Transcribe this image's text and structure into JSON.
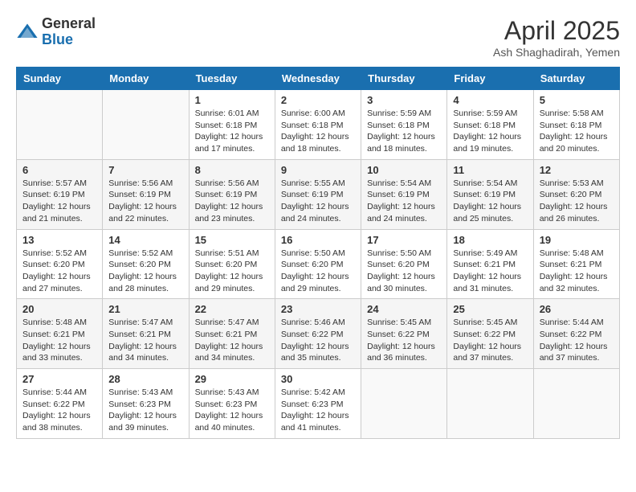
{
  "header": {
    "logo_general": "General",
    "logo_blue": "Blue",
    "month_year": "April 2025",
    "location": "Ash Shaghadirah, Yemen"
  },
  "weekdays": [
    "Sunday",
    "Monday",
    "Tuesday",
    "Wednesday",
    "Thursday",
    "Friday",
    "Saturday"
  ],
  "weeks": [
    [
      {
        "day": "",
        "sunrise": "",
        "sunset": "",
        "daylight": ""
      },
      {
        "day": "",
        "sunrise": "",
        "sunset": "",
        "daylight": ""
      },
      {
        "day": "1",
        "sunrise": "Sunrise: 6:01 AM",
        "sunset": "Sunset: 6:18 PM",
        "daylight": "Daylight: 12 hours and 17 minutes."
      },
      {
        "day": "2",
        "sunrise": "Sunrise: 6:00 AM",
        "sunset": "Sunset: 6:18 PM",
        "daylight": "Daylight: 12 hours and 18 minutes."
      },
      {
        "day": "3",
        "sunrise": "Sunrise: 5:59 AM",
        "sunset": "Sunset: 6:18 PM",
        "daylight": "Daylight: 12 hours and 18 minutes."
      },
      {
        "day": "4",
        "sunrise": "Sunrise: 5:59 AM",
        "sunset": "Sunset: 6:18 PM",
        "daylight": "Daylight: 12 hours and 19 minutes."
      },
      {
        "day": "5",
        "sunrise": "Sunrise: 5:58 AM",
        "sunset": "Sunset: 6:18 PM",
        "daylight": "Daylight: 12 hours and 20 minutes."
      }
    ],
    [
      {
        "day": "6",
        "sunrise": "Sunrise: 5:57 AM",
        "sunset": "Sunset: 6:19 PM",
        "daylight": "Daylight: 12 hours and 21 minutes."
      },
      {
        "day": "7",
        "sunrise": "Sunrise: 5:56 AM",
        "sunset": "Sunset: 6:19 PM",
        "daylight": "Daylight: 12 hours and 22 minutes."
      },
      {
        "day": "8",
        "sunrise": "Sunrise: 5:56 AM",
        "sunset": "Sunset: 6:19 PM",
        "daylight": "Daylight: 12 hours and 23 minutes."
      },
      {
        "day": "9",
        "sunrise": "Sunrise: 5:55 AM",
        "sunset": "Sunset: 6:19 PM",
        "daylight": "Daylight: 12 hours and 24 minutes."
      },
      {
        "day": "10",
        "sunrise": "Sunrise: 5:54 AM",
        "sunset": "Sunset: 6:19 PM",
        "daylight": "Daylight: 12 hours and 24 minutes."
      },
      {
        "day": "11",
        "sunrise": "Sunrise: 5:54 AM",
        "sunset": "Sunset: 6:19 PM",
        "daylight": "Daylight: 12 hours and 25 minutes."
      },
      {
        "day": "12",
        "sunrise": "Sunrise: 5:53 AM",
        "sunset": "Sunset: 6:20 PM",
        "daylight": "Daylight: 12 hours and 26 minutes."
      }
    ],
    [
      {
        "day": "13",
        "sunrise": "Sunrise: 5:52 AM",
        "sunset": "Sunset: 6:20 PM",
        "daylight": "Daylight: 12 hours and 27 minutes."
      },
      {
        "day": "14",
        "sunrise": "Sunrise: 5:52 AM",
        "sunset": "Sunset: 6:20 PM",
        "daylight": "Daylight: 12 hours and 28 minutes."
      },
      {
        "day": "15",
        "sunrise": "Sunrise: 5:51 AM",
        "sunset": "Sunset: 6:20 PM",
        "daylight": "Daylight: 12 hours and 29 minutes."
      },
      {
        "day": "16",
        "sunrise": "Sunrise: 5:50 AM",
        "sunset": "Sunset: 6:20 PM",
        "daylight": "Daylight: 12 hours and 29 minutes."
      },
      {
        "day": "17",
        "sunrise": "Sunrise: 5:50 AM",
        "sunset": "Sunset: 6:20 PM",
        "daylight": "Daylight: 12 hours and 30 minutes."
      },
      {
        "day": "18",
        "sunrise": "Sunrise: 5:49 AM",
        "sunset": "Sunset: 6:21 PM",
        "daylight": "Daylight: 12 hours and 31 minutes."
      },
      {
        "day": "19",
        "sunrise": "Sunrise: 5:48 AM",
        "sunset": "Sunset: 6:21 PM",
        "daylight": "Daylight: 12 hours and 32 minutes."
      }
    ],
    [
      {
        "day": "20",
        "sunrise": "Sunrise: 5:48 AM",
        "sunset": "Sunset: 6:21 PM",
        "daylight": "Daylight: 12 hours and 33 minutes."
      },
      {
        "day": "21",
        "sunrise": "Sunrise: 5:47 AM",
        "sunset": "Sunset: 6:21 PM",
        "daylight": "Daylight: 12 hours and 34 minutes."
      },
      {
        "day": "22",
        "sunrise": "Sunrise: 5:47 AM",
        "sunset": "Sunset: 6:21 PM",
        "daylight": "Daylight: 12 hours and 34 minutes."
      },
      {
        "day": "23",
        "sunrise": "Sunrise: 5:46 AM",
        "sunset": "Sunset: 6:22 PM",
        "daylight": "Daylight: 12 hours and 35 minutes."
      },
      {
        "day": "24",
        "sunrise": "Sunrise: 5:45 AM",
        "sunset": "Sunset: 6:22 PM",
        "daylight": "Daylight: 12 hours and 36 minutes."
      },
      {
        "day": "25",
        "sunrise": "Sunrise: 5:45 AM",
        "sunset": "Sunset: 6:22 PM",
        "daylight": "Daylight: 12 hours and 37 minutes."
      },
      {
        "day": "26",
        "sunrise": "Sunrise: 5:44 AM",
        "sunset": "Sunset: 6:22 PM",
        "daylight": "Daylight: 12 hours and 37 minutes."
      }
    ],
    [
      {
        "day": "27",
        "sunrise": "Sunrise: 5:44 AM",
        "sunset": "Sunset: 6:22 PM",
        "daylight": "Daylight: 12 hours and 38 minutes."
      },
      {
        "day": "28",
        "sunrise": "Sunrise: 5:43 AM",
        "sunset": "Sunset: 6:23 PM",
        "daylight": "Daylight: 12 hours and 39 minutes."
      },
      {
        "day": "29",
        "sunrise": "Sunrise: 5:43 AM",
        "sunset": "Sunset: 6:23 PM",
        "daylight": "Daylight: 12 hours and 40 minutes."
      },
      {
        "day": "30",
        "sunrise": "Sunrise: 5:42 AM",
        "sunset": "Sunset: 6:23 PM",
        "daylight": "Daylight: 12 hours and 41 minutes."
      },
      {
        "day": "",
        "sunrise": "",
        "sunset": "",
        "daylight": ""
      },
      {
        "day": "",
        "sunrise": "",
        "sunset": "",
        "daylight": ""
      },
      {
        "day": "",
        "sunrise": "",
        "sunset": "",
        "daylight": ""
      }
    ]
  ]
}
